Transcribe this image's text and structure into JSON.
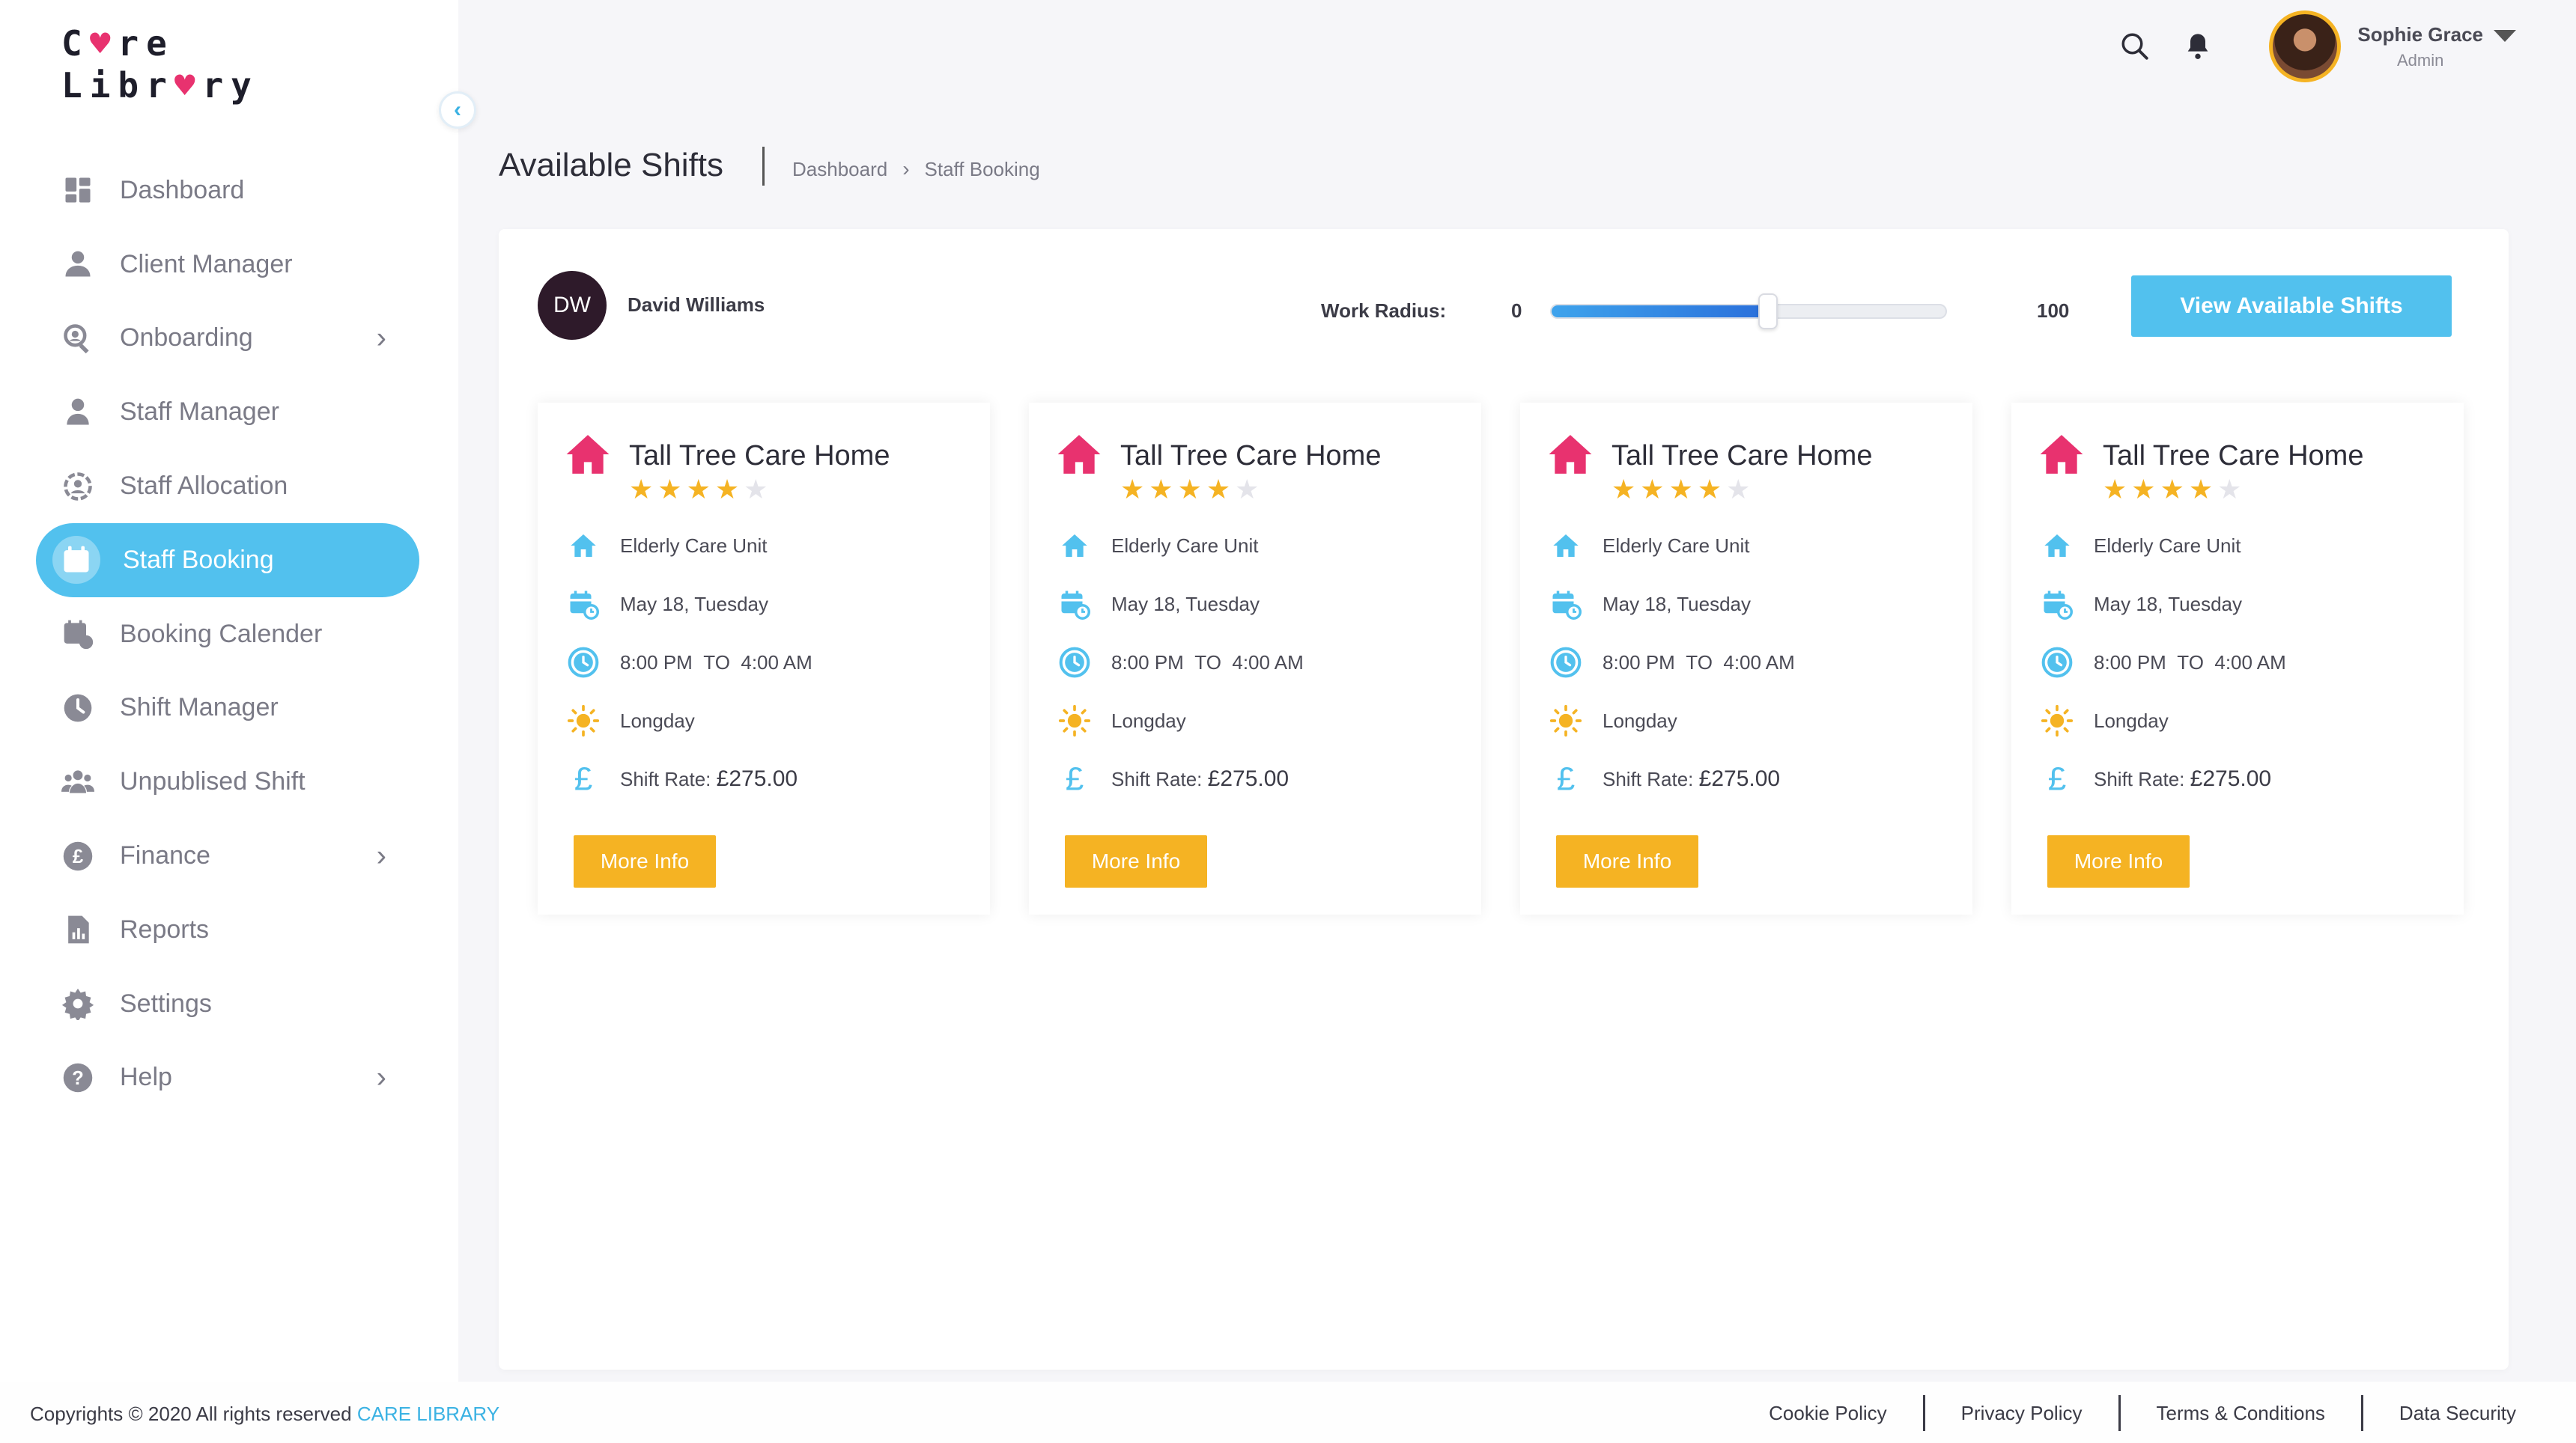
{
  "brand": {
    "logo_line1_a": "C",
    "logo_line1_heart": "♥",
    "logo_line1_b": "re",
    "logo_line2_a": "Libr",
    "logo_line2_heart": "♥",
    "logo_line2_b": "ry"
  },
  "sidebar": {
    "collapse_glyph": "‹",
    "items": [
      {
        "label": "Dashboard",
        "icon": "dashboard-icon",
        "has_arrow": false,
        "active": false
      },
      {
        "label": "Client Manager",
        "icon": "client-icon",
        "has_arrow": false,
        "active": false
      },
      {
        "label": "Onboarding",
        "icon": "onboarding-icon",
        "has_arrow": true,
        "active": false
      },
      {
        "label": "Staff Manager",
        "icon": "staff-icon",
        "has_arrow": false,
        "active": false
      },
      {
        "label": "Staff Allocation",
        "icon": "allocation-icon",
        "has_arrow": false,
        "active": false
      },
      {
        "label": "Staff Booking",
        "icon": "booking-icon",
        "has_arrow": false,
        "active": true
      },
      {
        "label": "Booking Calender",
        "icon": "calendar-icon",
        "has_arrow": false,
        "active": false
      },
      {
        "label": "Shift Manager",
        "icon": "clock-icon",
        "has_arrow": false,
        "active": false
      },
      {
        "label": "Unpublised Shift",
        "icon": "group-icon",
        "has_arrow": false,
        "active": false
      },
      {
        "label": "Finance",
        "icon": "pound-icon",
        "has_arrow": true,
        "active": false
      },
      {
        "label": "Reports",
        "icon": "report-icon",
        "has_arrow": false,
        "active": false
      },
      {
        "label": "Settings",
        "icon": "gear-icon",
        "has_arrow": false,
        "active": false
      },
      {
        "label": "Help",
        "icon": "help-icon",
        "has_arrow": true,
        "active": false
      }
    ],
    "arrow_glyph": "›"
  },
  "header": {
    "user_name": "Sophie Grace",
    "user_role": "Admin"
  },
  "page": {
    "title": "Available Shifts",
    "breadcrumb": [
      "Dashboard",
      "Staff Booking"
    ],
    "breadcrumb_sep": "›"
  },
  "booking": {
    "staff_initials": "DW",
    "staff_name": "David Williams",
    "radius_label": "Work Radius:",
    "radius_min": "0",
    "radius_max": "100",
    "radius_value_fraction": 0.55,
    "view_button": "View Available Shifts"
  },
  "cards": [
    {
      "title": "Tall Tree Care Home",
      "rating": 4,
      "unit": "Elderly Care Unit",
      "date": "May 18, Tuesday",
      "time_from": "8:00 PM",
      "time_to_label": "TO",
      "time_to": "4:00 AM",
      "shift_type": "Longday",
      "rate_label": "Shift Rate:",
      "rate_value": "£275.00",
      "button": "More Info"
    },
    {
      "title": "Tall Tree Care Home",
      "rating": 4,
      "unit": "Elderly Care Unit",
      "date": "May 18, Tuesday",
      "time_from": "8:00 PM",
      "time_to_label": "TO",
      "time_to": "4:00 AM",
      "shift_type": "Longday",
      "rate_label": "Shift Rate:",
      "rate_value": "£275.00",
      "button": "More Info"
    },
    {
      "title": "Tall Tree Care Home",
      "rating": 4,
      "unit": "Elderly Care Unit",
      "date": "May 18, Tuesday",
      "time_from": "8:00 PM",
      "time_to_label": "TO",
      "time_to": "4:00 AM",
      "shift_type": "Longday",
      "rate_label": "Shift Rate:",
      "rate_value": "£275.00",
      "button": "More Info"
    },
    {
      "title": "Tall Tree Care Home",
      "rating": 4,
      "unit": "Elderly Care Unit",
      "date": "May 18, Tuesday",
      "time_from": "8:00 PM",
      "time_to_label": "TO",
      "time_to": "4:00 AM",
      "shift_type": "Longday",
      "rate_label": "Shift Rate:",
      "rate_value": "£275.00",
      "button": "More Info"
    }
  ],
  "footer": {
    "copyright": "Copyrights © 2020  All rights reserved ",
    "brand": "CARE LIBRARY",
    "links": [
      "Cookie Policy",
      "Privacy Policy",
      "Terms & Conditions",
      "Data Security"
    ]
  },
  "colors": {
    "accent": "#52c1ee",
    "button_yellow": "#f5b323",
    "home_pink": "#e8326f",
    "star": "#f5b323"
  }
}
